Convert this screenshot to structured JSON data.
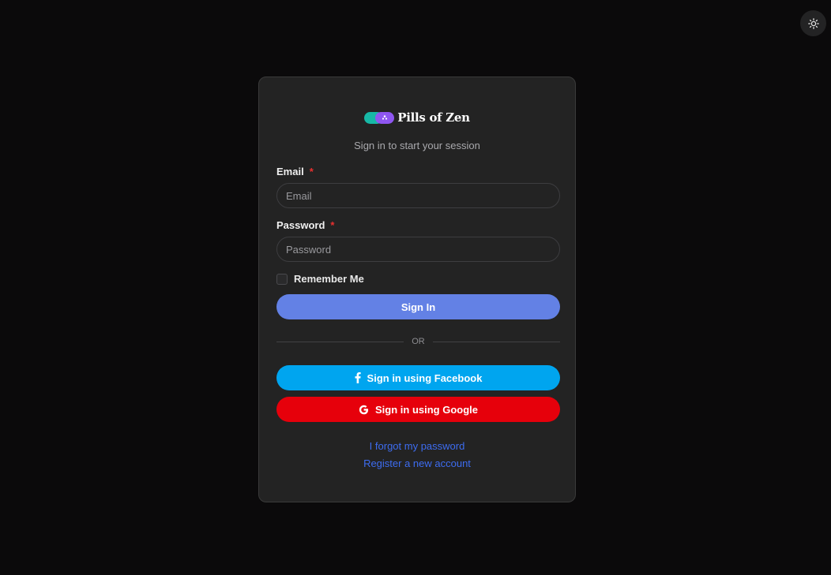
{
  "brand": {
    "name": "Pills of Zen",
    "colors": {
      "pill_left": "#17b8a6",
      "pill_right": "#8e56f0"
    }
  },
  "login": {
    "subtitle": "Sign in to start your session",
    "email": {
      "label": "Email",
      "required_marker": "*",
      "placeholder": "Email",
      "value": ""
    },
    "password": {
      "label": "Password",
      "required_marker": "*",
      "placeholder": "Password",
      "value": ""
    },
    "remember_label": "Remember Me",
    "remember_checked": false,
    "signin_label": "Sign In",
    "divider_text": "OR",
    "facebook_label": "Sign in using Facebook",
    "google_label": "Sign in using Google",
    "forgot_link": "I forgot my password",
    "register_link": "Register a new account"
  },
  "icons": {
    "theme_toggle": "sun-icon",
    "facebook": "facebook-icon",
    "google": "google-icon"
  },
  "colors": {
    "background": "#0b0a0b",
    "card": "#232323",
    "primary": "#6381e5",
    "facebook": "#00a5ef",
    "google": "#e6000b",
    "link": "#3d6cf0",
    "required": "#e8302f"
  }
}
